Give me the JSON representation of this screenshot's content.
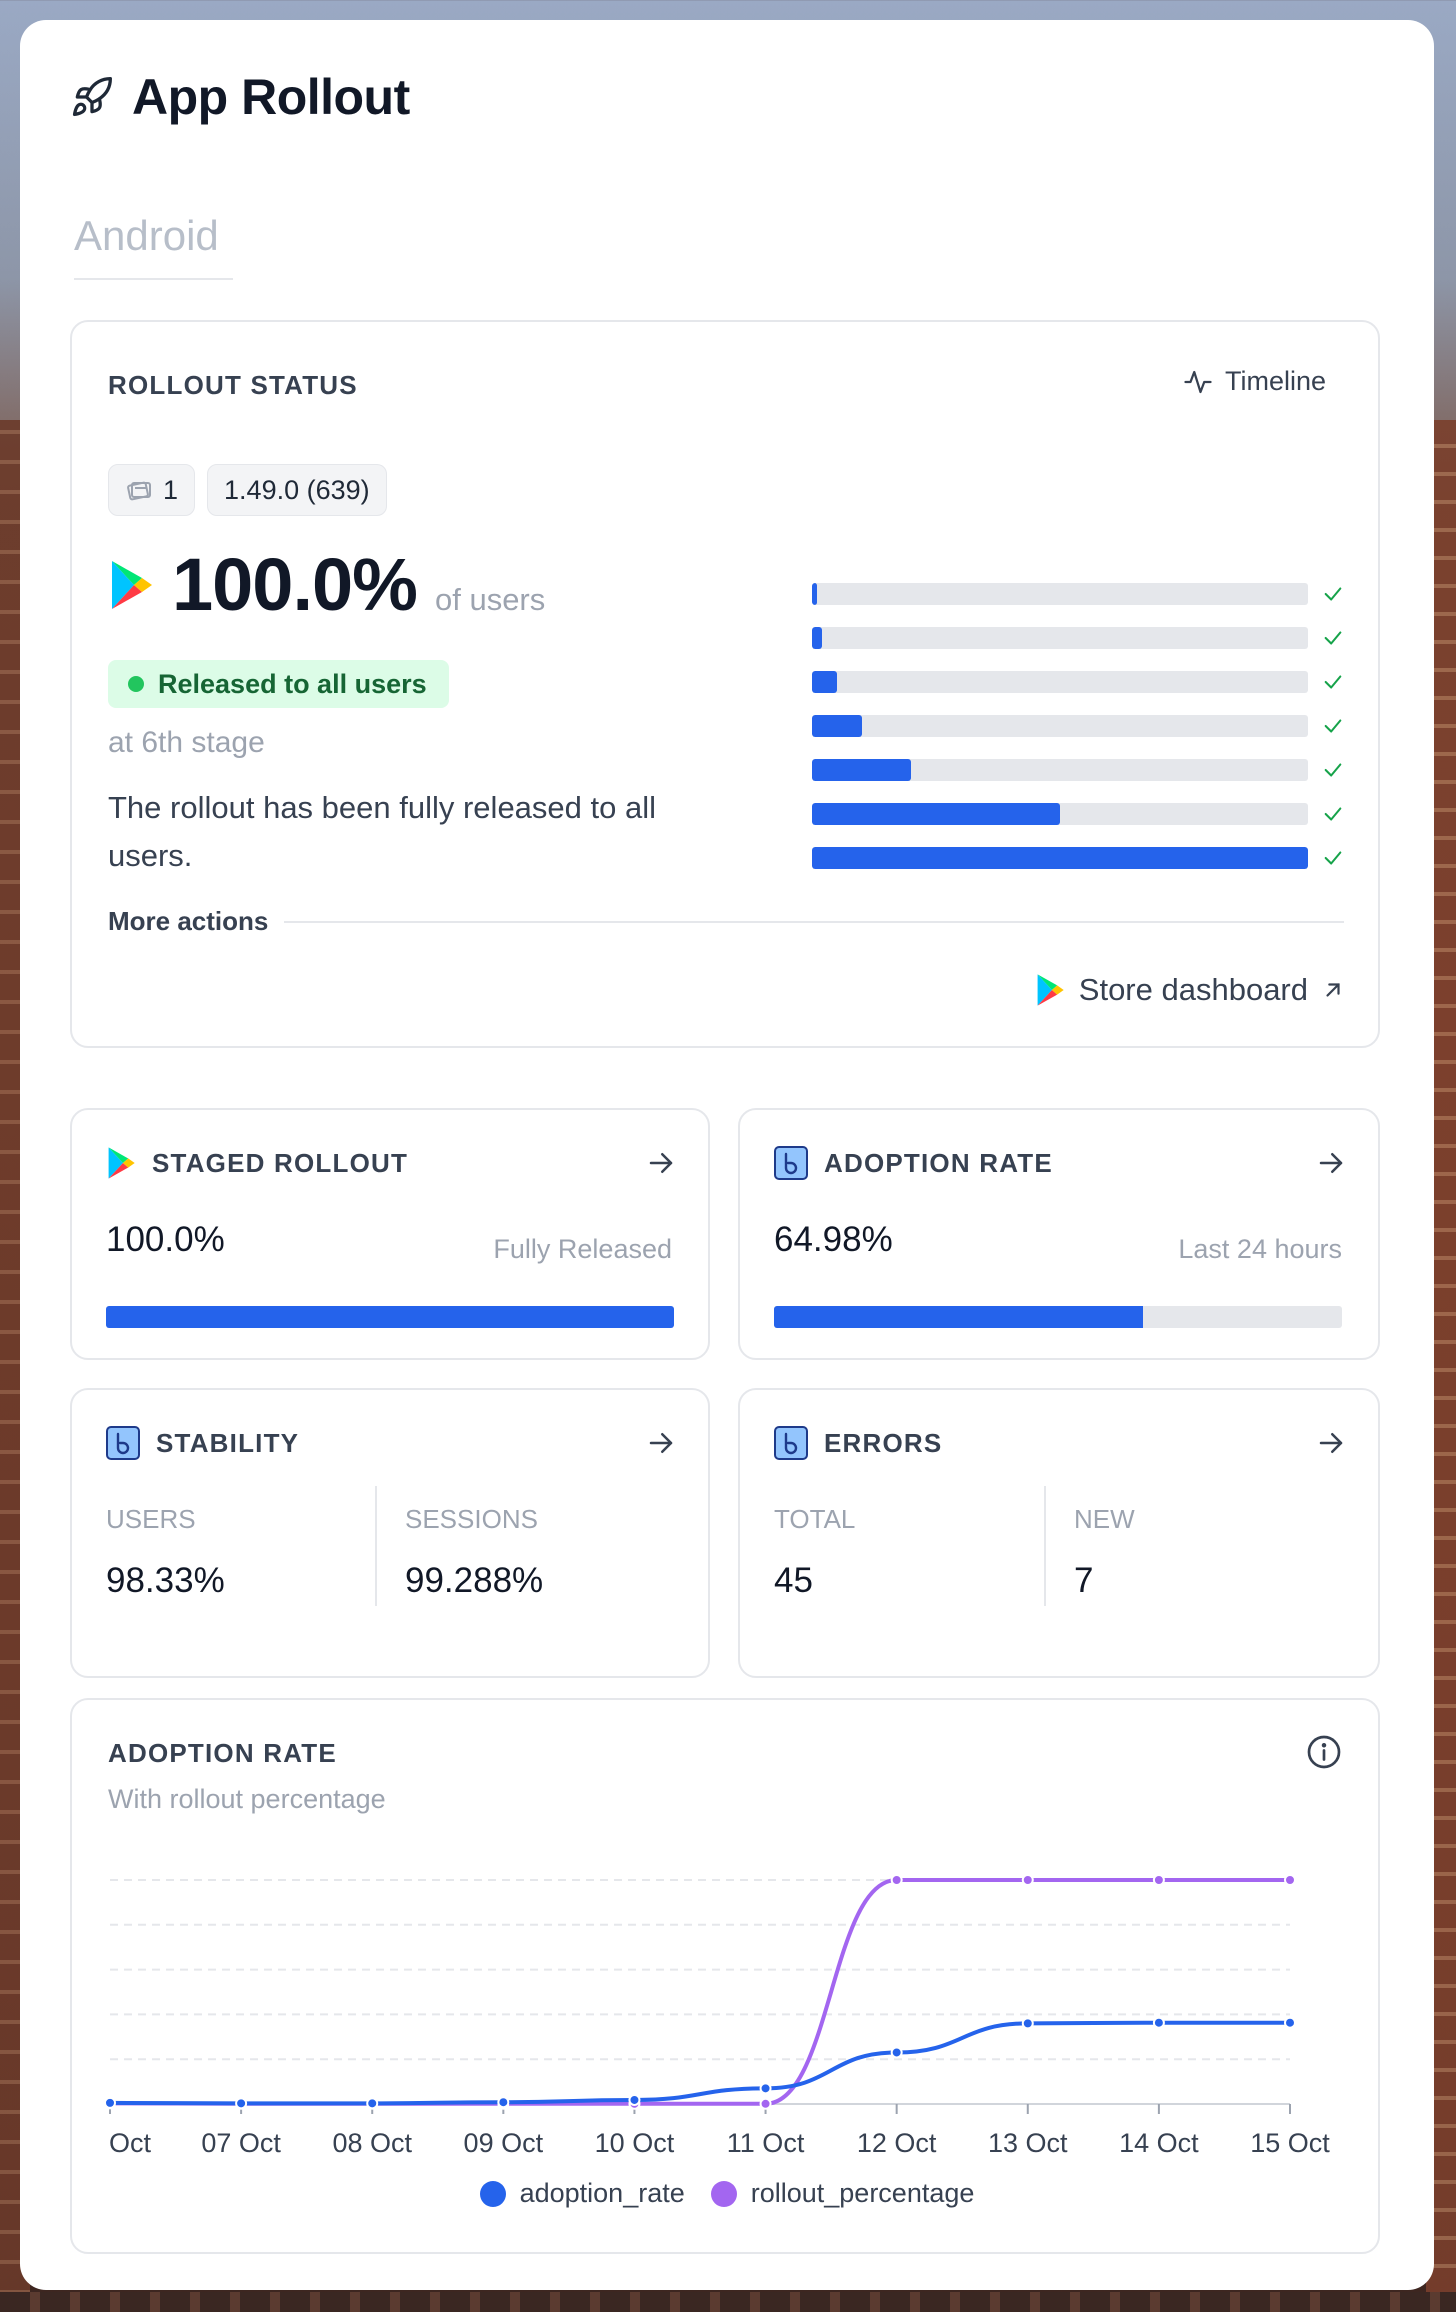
{
  "header": {
    "title": "App Rollout",
    "icon": "rocket-icon"
  },
  "tabs": [
    {
      "label": "Android",
      "active": false
    }
  ],
  "rollout_status": {
    "title": "ROLLOUT STATUS",
    "timeline_label": "Timeline",
    "chips": {
      "count": "1",
      "version": "1.49.0 (639)"
    },
    "percent": "100.0%",
    "percent_suffix": "of users",
    "badge": "Released to all users",
    "stage": "at 6th stage",
    "description": "The rollout has been fully released to all users.",
    "stages": [
      0.01,
      0.02,
      0.05,
      0.1,
      0.2,
      0.5,
      1.0
    ],
    "more_actions": "More actions",
    "store_link": "Store dashboard"
  },
  "staged_rollout": {
    "title": "STAGED ROLLOUT",
    "value": "100.0%",
    "caption": "Fully Released",
    "fill": 1.0
  },
  "adoption_rate_card": {
    "title": "ADOPTION RATE",
    "value": "64.98%",
    "caption": "Last 24 hours",
    "fill": 0.6498
  },
  "stability": {
    "title": "STABILITY",
    "users_label": "USERS",
    "users_value": "98.33%",
    "sessions_label": "SESSIONS",
    "sessions_value": "99.288%"
  },
  "errors": {
    "title": "ERRORS",
    "total_label": "TOTAL",
    "total_value": "45",
    "new_label": "NEW",
    "new_value": "7"
  },
  "adoption_chart": {
    "title": "ADOPTION RATE",
    "subtitle": "With rollout percentage"
  },
  "colors": {
    "accent": "#2563eb",
    "rollout": "#a366f0",
    "success": "#22c55e"
  },
  "chart_data": {
    "type": "line",
    "x": [
      "Oct",
      "07 Oct",
      "08 Oct",
      "09 Oct",
      "10 Oct",
      "11 Oct",
      "12 Oct",
      "13 Oct",
      "14 Oct",
      "15 Oct"
    ],
    "ylim": [
      0,
      100
    ],
    "series": [
      {
        "name": "adoption_rate",
        "color": "#2563eb",
        "values": [
          0.5,
          0.3,
          0.3,
          0.8,
          1.8,
          7,
          23,
          36,
          36.3,
          36.3
        ]
      },
      {
        "name": "rollout_percentage",
        "color": "#a366f0",
        "values": [
          0.3,
          0.1,
          0.1,
          0.1,
          0.1,
          0.1,
          100,
          100,
          100,
          100
        ]
      }
    ],
    "grid": true,
    "legend": "bottom"
  }
}
